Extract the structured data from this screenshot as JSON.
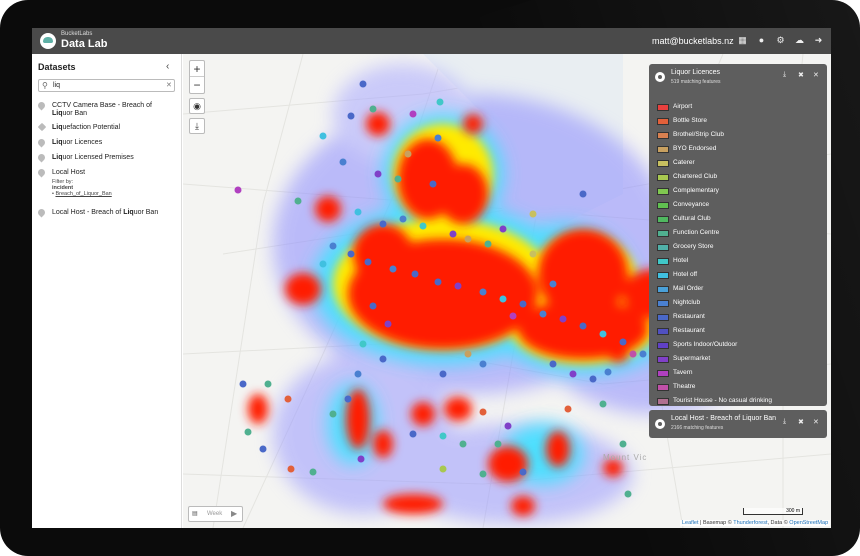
{
  "app": {
    "brand_small": "BucketLabs",
    "brand": "Data Lab",
    "user_email": "matt@bucketlabs.nz"
  },
  "sidebar": {
    "title": "Datasets",
    "search_value": "liq",
    "items": [
      {
        "label_before": "CCTV Camera Base - Breach of ",
        "label_bold": "Liq",
        "label_after": "uor Ban"
      },
      {
        "label_before": "",
        "label_bold": "Liq",
        "label_after": "uefaction Potential"
      },
      {
        "label_before": "",
        "label_bold": "Liq",
        "label_after": "uor Licences"
      },
      {
        "label_before": "",
        "label_bold": "Liq",
        "label_after": "uor Licensed Premises"
      },
      {
        "label_before": "Local Host",
        "label_bold": "",
        "label_after": ""
      },
      {
        "label_before": "Local Host - Breach of ",
        "label_bold": "Liq",
        "label_after": "uor Ban"
      }
    ],
    "filter": {
      "label": "Filter by:",
      "field": "incident",
      "value": "Breach_of_Liquor_Ban"
    }
  },
  "map": {
    "place_label": "Mount Vic",
    "scale_label": "300 m",
    "attribution": {
      "leaflet": "Leaflet",
      "sep1": " | Basemap © ",
      "thunderforest": "Thunderforest",
      "sep2": ", Data © ",
      "osm": "OpenStreetMap"
    },
    "time_label": "Week"
  },
  "layers": [
    {
      "title": "Liquor Licences",
      "count": "519 matching features",
      "legend": [
        {
          "label": "Airport",
          "color": "#e8403e"
        },
        {
          "label": "Bottle Store",
          "color": "#e2603a"
        },
        {
          "label": "Brothel/Strip Club",
          "color": "#d88050"
        },
        {
          "label": "BYO Endorsed",
          "color": "#c8a060"
        },
        {
          "label": "Caterer",
          "color": "#c8c060"
        },
        {
          "label": "Chartered Club",
          "color": "#a8c850"
        },
        {
          "label": "Complementary",
          "color": "#80c850"
        },
        {
          "label": "Conveyance",
          "color": "#60c050"
        },
        {
          "label": "Cultural Club",
          "color": "#50b860"
        },
        {
          "label": "Function Centre",
          "color": "#50b090"
        },
        {
          "label": "Grocery Store",
          "color": "#50b0a8"
        },
        {
          "label": "Hotel",
          "color": "#40c8c8"
        },
        {
          "label": "Hotel off",
          "color": "#40c0e0"
        },
        {
          "label": "Mail Order",
          "color": "#4aa0d8"
        },
        {
          "label": "Nightclub",
          "color": "#4a80d0"
        },
        {
          "label": "Restaurant",
          "color": "#4a68c8"
        },
        {
          "label": "Restaurant",
          "color": "#5050c0"
        },
        {
          "label": "Sports Indoor/Outdoor",
          "color": "#6040c8"
        },
        {
          "label": "Supermarket",
          "color": "#8040c8"
        },
        {
          "label": "Tavern",
          "color": "#b040c0"
        },
        {
          "label": "Theatre",
          "color": "#c050a8"
        },
        {
          "label": "Tourist House - No casual drinking",
          "color": "#b07090"
        }
      ]
    },
    {
      "title": "Local Host - Breach of Liquor Ban",
      "count": "2166 matching features"
    }
  ]
}
